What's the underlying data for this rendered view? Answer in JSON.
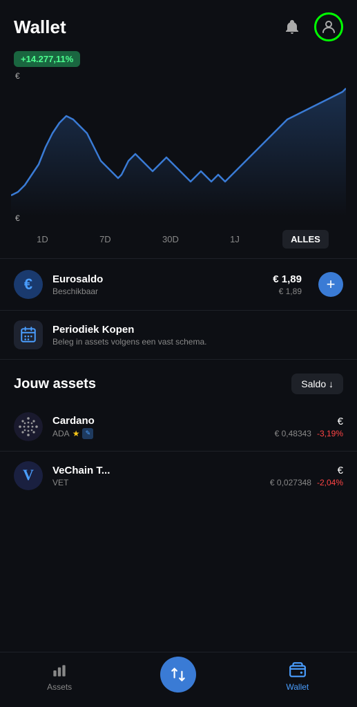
{
  "header": {
    "title": "Wallet"
  },
  "badge": {
    "value": "+14.277,11%"
  },
  "chart": {
    "euro_label_top": "€",
    "euro_label_bottom": "€"
  },
  "time_range": {
    "options": [
      "1D",
      "7D",
      "30D",
      "1J",
      "ALLES"
    ],
    "active": "ALLES"
  },
  "eurosaldo": {
    "name": "Eurosaldo",
    "sub": "Beschikbaar",
    "amount": "€ 1,89",
    "amount_sub": "€ 1,89"
  },
  "periodiek": {
    "name": "Periodiek Kopen",
    "sub": "Beleg in assets volgens een vast schema."
  },
  "assets_section": {
    "title": "Jouw assets",
    "sort_btn": "Saldo ↓"
  },
  "assets": [
    {
      "name": "Cardano",
      "ticker": "ADA",
      "value": "€",
      "price": "€ 0,48343",
      "change": "-3,19%"
    },
    {
      "name": "VeChain T...",
      "ticker": "VET",
      "value": "€",
      "price": "€ 0,027348",
      "change": "-2,04%"
    }
  ],
  "bottom_nav": {
    "items": [
      {
        "label": "Assets",
        "icon": "bar-chart-icon",
        "active": false
      },
      {
        "label": "",
        "icon": "swap-icon",
        "active": false,
        "center": true
      },
      {
        "label": "Wallet",
        "icon": "wallet-icon",
        "active": true
      }
    ]
  }
}
